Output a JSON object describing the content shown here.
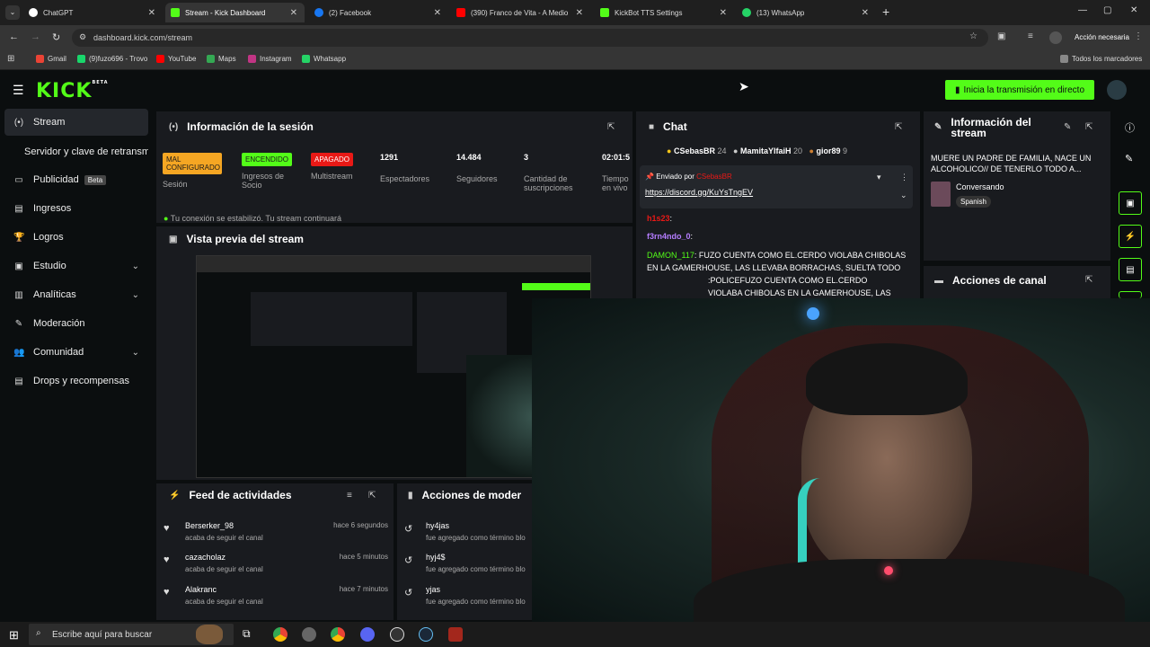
{
  "browser": {
    "tabs": [
      {
        "label": "ChatGPT",
        "color": "#ffffff"
      },
      {
        "label": "Stream - Kick Dashboard",
        "color": "#53fc18"
      },
      {
        "label": "(2) Facebook",
        "color": "#1877f2"
      },
      {
        "label": "(390) Franco de Vita - A Medio",
        "color": "#ff0000"
      },
      {
        "label": "KickBot TTS Settings",
        "color": "#53fc18"
      },
      {
        "label": "(13) WhatsApp",
        "color": "#25d366"
      }
    ],
    "new_tab": "+",
    "url": "dashboard.kick.com/stream",
    "action_button": "Acción necesaria",
    "bookmarks": [
      "Gmail",
      "(9)fuzo696 - Trovo",
      "YouTube",
      "Maps",
      "Instagram",
      "Whatsapp"
    ],
    "all_bookmarks": "Todos los marcadores"
  },
  "header": {
    "logo": "KICK",
    "logo_sup": "BETA",
    "go_live": "Inicia la transmisión en directo"
  },
  "sidebar": {
    "items": [
      {
        "label": "Stream",
        "icon": "(•)"
      },
      {
        "label": "Servidor y clave de retransmisión",
        "icon": ""
      },
      {
        "label": "Publicidad",
        "icon": "▭",
        "badge": "Beta"
      },
      {
        "label": "Ingresos",
        "icon": "▤"
      },
      {
        "label": "Logros",
        "icon": "🏆"
      },
      {
        "label": "Estudio",
        "icon": "▣"
      },
      {
        "label": "Analíticas",
        "icon": "▥"
      },
      {
        "label": "Moderación",
        "icon": "✎"
      },
      {
        "label": "Comunidad",
        "icon": "👥"
      },
      {
        "label": "Drops y recompensas",
        "icon": "▤"
      }
    ]
  },
  "session": {
    "title": "Información de la sesión",
    "stats": [
      {
        "badge": "MAL CONFIGURADO",
        "badge_color": "#f5a623",
        "label": "Sesión"
      },
      {
        "badge": "ENCENDIDO",
        "badge_color": "#53fc18",
        "label": "Ingresos de Socio"
      },
      {
        "badge": "APAGADO",
        "badge_color": "#e91916",
        "label": "Multistream"
      },
      {
        "value": "1291",
        "label": "Espectadores"
      },
      {
        "value": "14.484",
        "label": "Seguidores"
      },
      {
        "value": "3",
        "label": "Cantidad de suscripciones"
      },
      {
        "value": "02:01:5",
        "label": "Tiempo en vivo"
      }
    ],
    "notice": "Tu conexión se estabilizó. Tu stream continuará"
  },
  "preview": {
    "title": "Vista previa del stream"
  },
  "feed": {
    "title": "Feed de actividades",
    "items": [
      {
        "name": "Berserker_98",
        "sub": "acaba de seguir el canal",
        "time": "hace 6 segundos"
      },
      {
        "name": "cazacholaz",
        "sub": "acaba de seguir el canal",
        "time": "hace 5 minutos"
      },
      {
        "name": "Alakranc",
        "sub": "acaba de seguir el canal",
        "time": "hace 7 minutos"
      }
    ]
  },
  "moderation": {
    "title": "Acciones de moder",
    "items": [
      {
        "name": "hy4jas",
        "sub": "fue agregado como término blo"
      },
      {
        "name": "hyj4$",
        "sub": "fue agregado como término blo"
      },
      {
        "name": "yjas",
        "sub": "fue agregado como término blo"
      }
    ]
  },
  "chat": {
    "title": "Chat",
    "top_gifters": [
      {
        "name": "CSebasBR",
        "count": "24"
      },
      {
        "name": "MamitaYlfaiH",
        "count": "20"
      },
      {
        "name": "gior89",
        "count": "9"
      }
    ],
    "pinned_prefix": "Enviado por",
    "pinned_user": "CSebasBR",
    "pinned_link": "https://discord.gg/KuYsTngEV",
    "messages": [
      {
        "user": "h1s23",
        "user_color": "#e91916",
        "text": ":"
      },
      {
        "user": "f3rn4ndo_0",
        "user_color": "#b57dff",
        "text": ":"
      },
      {
        "user": "DAMON_117",
        "user_color": "#53fc18",
        "text": ": FUZO CUENTA COMO EL.CERDO VIOLABA CHIBOLAS EN LA GAMERHOUSE, LAS LLEVABA BORRACHAS, SUELTA TODO"
      },
      {
        "user": "",
        "user_color": "#ffffff",
        "text": ":POLICEFUZO CUENTA COMO EL.CERDO VIOLABA CHIBOLAS EN LA GAMERHOUSE, LAS LLEVABA"
      }
    ]
  },
  "stream_info": {
    "title": "Información del stream",
    "description": "MUERE UN PADRE DE FAMILIA, NACE UN ALCOHOLICO// DE TENERLO TODO A...",
    "category": "Conversando",
    "language": "Spanish"
  },
  "channel_actions": {
    "title": "Acciones de canal"
  },
  "taskbar": {
    "search_placeholder": "Escribe aquí para buscar"
  }
}
